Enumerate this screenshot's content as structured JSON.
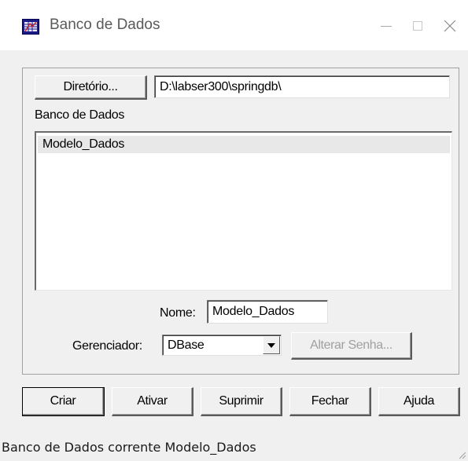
{
  "window": {
    "title": "Banco de Dados",
    "icon": "database-app-icon"
  },
  "titlebar_buttons": {
    "minimize_icon": "minimize-icon",
    "maximize_icon": "maximize-icon",
    "close_icon": "close-icon"
  },
  "directory": {
    "button_label": "Diretório...",
    "path_value": "D:\\labser300\\springdb\\"
  },
  "database_list": {
    "label": "Banco de Dados",
    "items": [
      "Modelo_Dados"
    ],
    "selected_index": 0
  },
  "name_field": {
    "label": "Nome:",
    "value": "Modelo_Dados"
  },
  "manager": {
    "label": "Gerenciador:",
    "selected": "DBase",
    "arrow_icon": "dropdown-arrow-icon",
    "change_password_label": "Alterar Senha..."
  },
  "actions": {
    "create": "Criar",
    "activate": "Ativar",
    "delete": "Suprimir",
    "close": "Fechar",
    "help": "Ajuda"
  },
  "status": {
    "text": "Banco de Dados corrente Modelo_Dados",
    "grip_icon": "resize-grip-icon"
  },
  "colors": {
    "window_bg": "#f0f0f0",
    "titlebar_bg": "#ffffff",
    "selection_bg": "#e8e8e8",
    "disabled_text": "#a0a0a0"
  }
}
